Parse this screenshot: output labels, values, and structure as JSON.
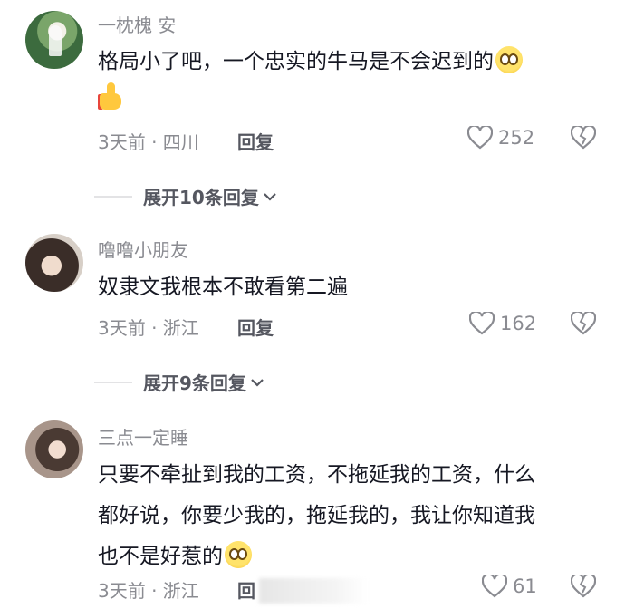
{
  "comments": [
    {
      "username": "一枕槐 安",
      "text": "格局小了吧，一个忠实的牛马是不会迟到的",
      "emoji": [
        "grinning-face-emoji",
        "thumbs-up-emoji"
      ],
      "meta": "3天前 · 四川",
      "reply_label": "回复",
      "likes": "252",
      "expand_label": "展开10条回复"
    },
    {
      "username": "噜噜小朋友",
      "text": "奴隶文我根本不敢看第二遍",
      "meta": "3天前 · 浙江",
      "reply_label": "回复",
      "likes": "162",
      "expand_label": "展开9条回复"
    },
    {
      "username": "三点一定睡",
      "text_lines": [
        "只要不牵扯到我的工资，不拖延我的工资，什么",
        "都好说，你要少我的，拖延我的，我让你知道我",
        "也不是好惹的"
      ],
      "emoji": [
        "grinning-face-emoji"
      ],
      "meta": "3天前 · 浙江",
      "reply_label": "回",
      "likes": "61"
    }
  ],
  "colors": {
    "text": "#161823",
    "secondary": "#8a8b91",
    "icon": "#8a8b91"
  }
}
